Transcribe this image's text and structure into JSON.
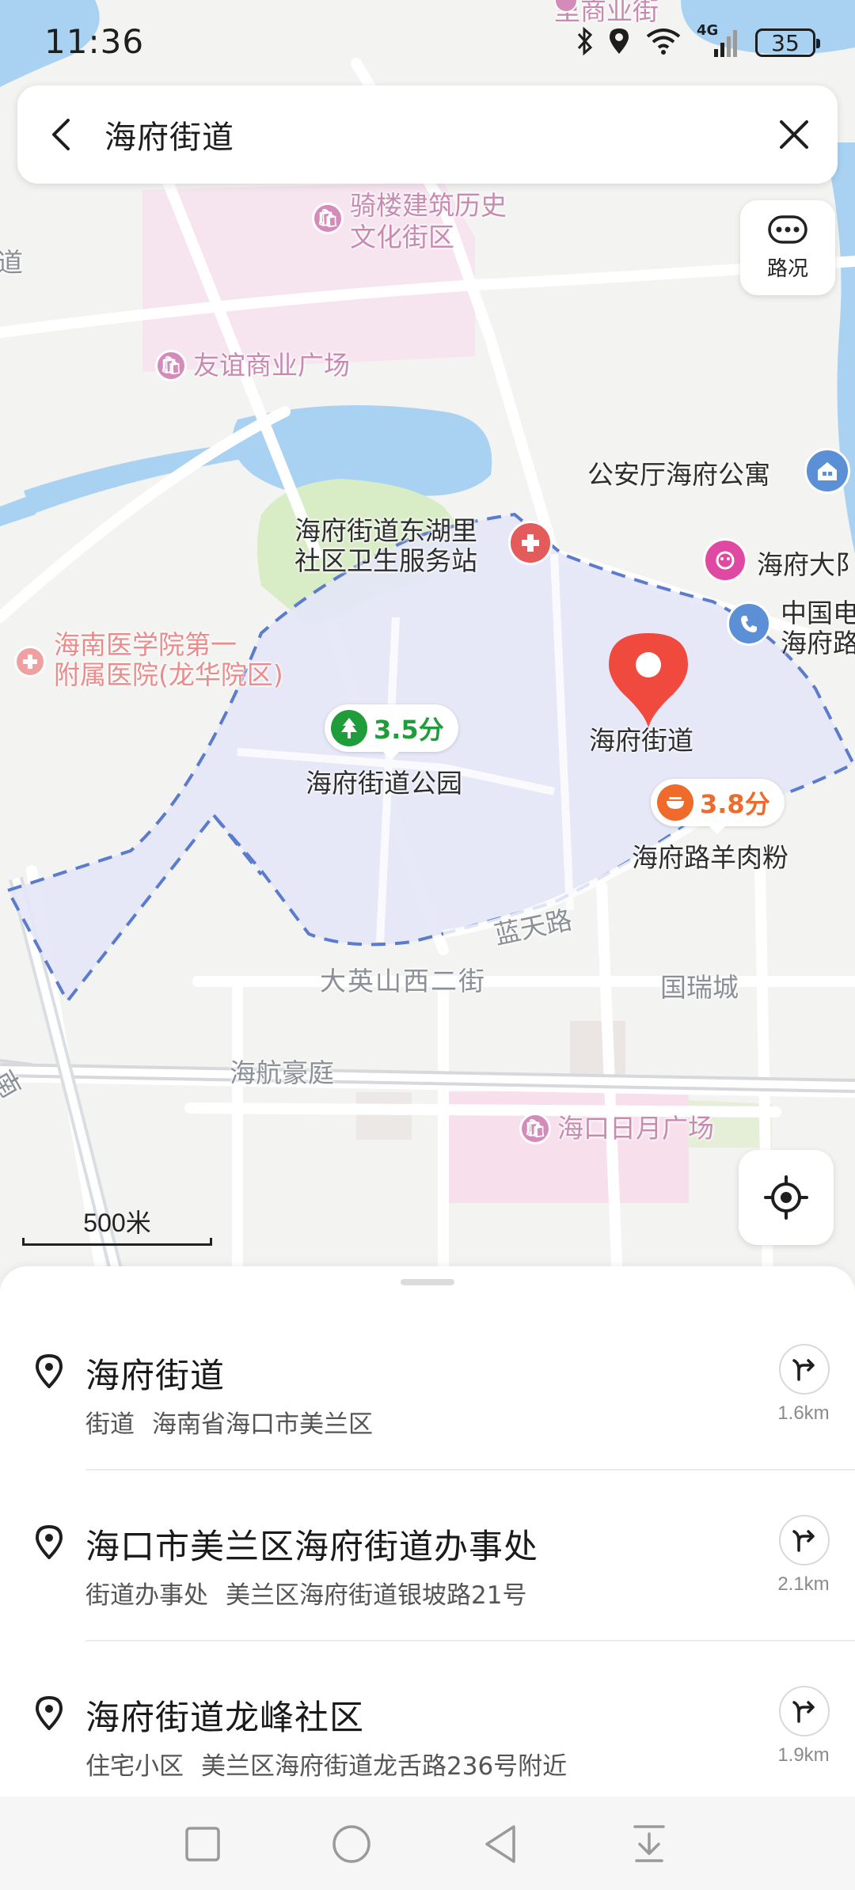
{
  "status_bar": {
    "time": "11:36",
    "battery": "35",
    "network": "4G"
  },
  "search": {
    "query": "海府街道",
    "back_icon": "chevron-left-icon",
    "clear_icon": "close-icon"
  },
  "map": {
    "traffic_label": "路况",
    "scale_label": "500米",
    "labels": {
      "top_street": "里商业街",
      "arcade": "骑楼建筑历史\n文化街区",
      "friendship_plaza": "友谊商业广场",
      "police_apartment": "公安厅海府公寓",
      "health_station": "海府街道东湖里\n社区卫生服务站",
      "haifu_daxia": "海府大阝",
      "china_telecom": "中国电\n海府路",
      "hospital": "海南医学院第一\n附属医院(龙华院区)",
      "haifu_park": "海府街道公园",
      "haifu_street_marker": "海府街道",
      "mutton_noodle": "海府路羊肉粉",
      "lantian_road": "蓝天路",
      "dayingshan": "大英山西二街",
      "guorui": "国瑞城",
      "haihang": "海航豪庭",
      "riyue_plaza": "海口日月广场",
      "left_edge_1": "道",
      "left_edge_2": "南"
    },
    "ratings": {
      "park": "3.5分",
      "mutton": "3.8分"
    },
    "colors": {
      "area_fill": "#e4e5f7",
      "area_border": "#5b7ccc",
      "water": "#a9d2f2",
      "green": "#d8ecc6",
      "marker": "#f04a3f",
      "rating_green": "#1f9d3b",
      "rating_orange": "#ee6b2c"
    }
  },
  "results": [
    {
      "title": "海府街道",
      "category": "街道",
      "address": "海南省海口市美兰区",
      "distance": "1.6km"
    },
    {
      "title": "海口市美兰区海府街道办事处",
      "category": "街道办事处",
      "address": "美兰区海府街道银坡路21号",
      "distance": "2.1km"
    },
    {
      "title": "海府街道龙峰社区",
      "category": "住宅小区",
      "address": "美兰区海府街道龙舌路236号附近",
      "distance": "1.9km"
    }
  ],
  "nav_bar": {
    "items": [
      "square-icon",
      "circle-icon",
      "triangle-back-icon",
      "download-icon"
    ]
  }
}
